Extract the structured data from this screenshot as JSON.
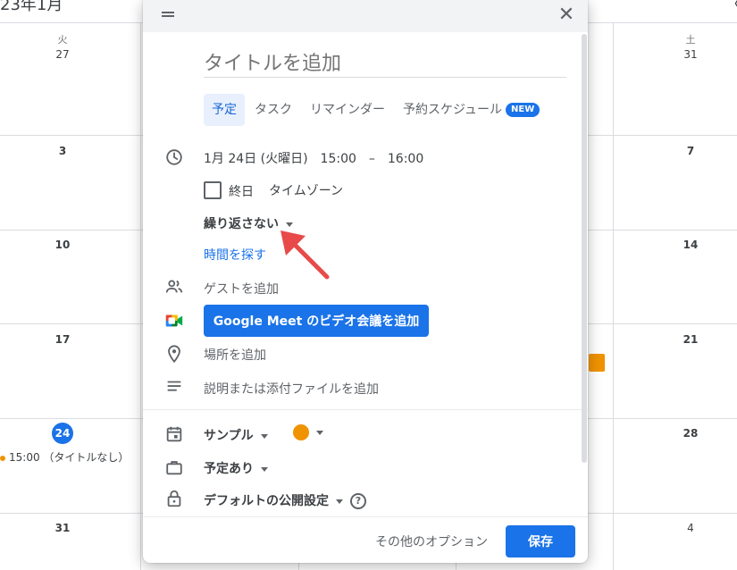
{
  "background_calendar": {
    "clipped_header_text": "23年1月",
    "clipped_right_glyph": "〈",
    "columns": [
      {
        "dayname": "火",
        "dates": [
          "27",
          "3",
          "10",
          "17",
          "24",
          "31"
        ]
      },
      {
        "dayname": "土",
        "dates": [
          "31",
          "7",
          "14",
          "21",
          "28",
          "4"
        ]
      }
    ],
    "today_date": "24",
    "event_text": "15:00 （タイトルなし）"
  },
  "dialog": {
    "close_glyph": "✕",
    "title_placeholder": "タイトルを追加",
    "tabs": [
      {
        "label": "予定",
        "active": true
      },
      {
        "label": "タスク",
        "active": false
      },
      {
        "label": "リマインダー",
        "active": false
      },
      {
        "label": "予約スケジュール",
        "active": false,
        "badge": "NEW"
      }
    ],
    "datetime": "1月 24日 (火曜日)　15:00　–　16:00",
    "allday_label": "終日",
    "timezone_label": "タイムゾーン",
    "repeat_label": "繰り返さない",
    "find_time_label": "時間を探す",
    "guest_label": "ゲストを追加",
    "meet_button_label": "Google Meet のビデオ会議を追加",
    "location_label": "場所を追加",
    "description_label": "説明または添付ファイルを追加",
    "calendar_label": "サンプル",
    "calendar_color": "#f09300",
    "busy_label": "予定あり",
    "visibility_label": "デフォルトの公開設定",
    "help_glyph": "?",
    "more_options_label": "その他のオプション",
    "save_label": "保存"
  },
  "colors": {
    "accent": "#1a73e8",
    "annotation_arrow": "#e84a4a",
    "event_orange": "#f09300"
  }
}
